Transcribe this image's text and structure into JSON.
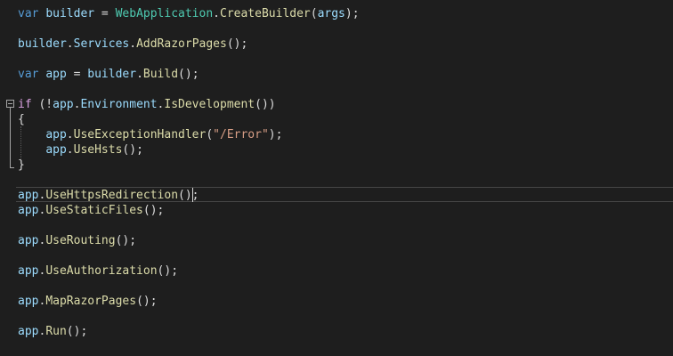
{
  "code_lines": [
    [
      {
        "t": "var",
        "c": "kw"
      },
      {
        "t": " "
      },
      {
        "t": "builder",
        "c": "var"
      },
      {
        "t": " = "
      },
      {
        "t": "WebApplication",
        "c": "type"
      },
      {
        "t": "."
      },
      {
        "t": "CreateBuilder",
        "c": "fn"
      },
      {
        "t": "("
      },
      {
        "t": "args",
        "c": "var"
      },
      {
        "t": ");"
      }
    ],
    [
      {
        "t": "builder",
        "c": "var"
      },
      {
        "t": "."
      },
      {
        "t": "Services",
        "c": "var"
      },
      {
        "t": "."
      },
      {
        "t": "AddRazorPages",
        "c": "fn"
      },
      {
        "t": "();"
      }
    ],
    [
      {
        "t": "var",
        "c": "kw"
      },
      {
        "t": " "
      },
      {
        "t": "app",
        "c": "var"
      },
      {
        "t": " = "
      },
      {
        "t": "builder",
        "c": "var"
      },
      {
        "t": "."
      },
      {
        "t": "Build",
        "c": "fn"
      },
      {
        "t": "();"
      }
    ],
    [
      {
        "t": "if",
        "c": "ctl"
      },
      {
        "t": " (!"
      },
      {
        "t": "app",
        "c": "var"
      },
      {
        "t": "."
      },
      {
        "t": "Environment",
        "c": "var"
      },
      {
        "t": "."
      },
      {
        "t": "IsDevelopment",
        "c": "fn"
      },
      {
        "t": "())"
      }
    ],
    [
      {
        "t": "{"
      }
    ],
    [
      {
        "t": "    "
      },
      {
        "t": "app",
        "c": "var"
      },
      {
        "t": "."
      },
      {
        "t": "UseExceptionHandler",
        "c": "fn"
      },
      {
        "t": "("
      },
      {
        "t": "\"/Error\"",
        "c": "str"
      },
      {
        "t": ");"
      }
    ],
    [
      {
        "t": "    "
      },
      {
        "t": "app",
        "c": "var"
      },
      {
        "t": "."
      },
      {
        "t": "UseHsts",
        "c": "fn"
      },
      {
        "t": "();"
      }
    ],
    [
      {
        "t": "}"
      }
    ],
    [
      {
        "t": "app",
        "c": "var"
      },
      {
        "t": "."
      },
      {
        "t": "UseHttpsRedirection",
        "c": "fn"
      },
      {
        "t": "();"
      }
    ],
    [
      {
        "t": "app",
        "c": "var"
      },
      {
        "t": "."
      },
      {
        "t": "UseStaticFiles",
        "c": "fn"
      },
      {
        "t": "();"
      }
    ],
    [
      {
        "t": "app",
        "c": "var"
      },
      {
        "t": "."
      },
      {
        "t": "UseRouting",
        "c": "fn"
      },
      {
        "t": "();"
      }
    ],
    [
      {
        "t": "app",
        "c": "var"
      },
      {
        "t": "."
      },
      {
        "t": "UseAuthorization",
        "c": "fn"
      },
      {
        "t": "();"
      }
    ],
    [
      {
        "t": "app",
        "c": "var"
      },
      {
        "t": "."
      },
      {
        "t": "MapRazorPages",
        "c": "fn"
      },
      {
        "t": "();"
      }
    ],
    [
      {
        "t": "app",
        "c": "var"
      },
      {
        "t": "."
      },
      {
        "t": "Run",
        "c": "fn"
      },
      {
        "t": "();"
      }
    ]
  ],
  "colors": {
    "background": "#1e1e1e",
    "keyword": "#569cd6",
    "control_keyword": "#d8a0df",
    "variable": "#9cdcfe",
    "type": "#4ec9b0",
    "method": "#dcdcaa",
    "string": "#d69d85",
    "punctuation": "#dcdcdc"
  }
}
